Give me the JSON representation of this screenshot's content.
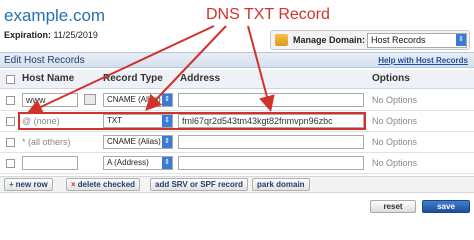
{
  "header": {
    "domain": "example.com",
    "expiration_label": "Expiration:",
    "expiration_date": "11/25/2019",
    "manage_label": "Manage Domain:",
    "manage_value": "Host Records"
  },
  "annotation": {
    "title": "DNS TXT Record",
    "color": "#d2322c"
  },
  "section": {
    "title": "Edit Host Records",
    "help_link": "Help with Host Records"
  },
  "columns": {
    "host": "Host Name",
    "type": "Record Type",
    "address": "Address",
    "options": "Options"
  },
  "rows": [
    {
      "host": "www",
      "type": "CNAME (Alias)",
      "address": "",
      "options": "No Options"
    },
    {
      "host": "@ (none)",
      "type": "TXT",
      "address": "fml67qr2d543tm43kgt82fnmvpn96zbc",
      "options": "No Options"
    },
    {
      "host": "* (all others)",
      "type": "CNAME (Alias)",
      "address": "",
      "options": "No Options"
    },
    {
      "host": "",
      "type": "A (Address)",
      "address": "",
      "options": "No Options"
    }
  ],
  "footer_buttons": {
    "new_row": "new row",
    "delete_checked": "delete checked",
    "add_srv": "add SRV or SPF record",
    "park_domain": "park domain"
  },
  "actions": {
    "reset": "reset",
    "save": "save"
  },
  "colors": {
    "accent": "#2a6fb0",
    "section_bg": "#d6e0ee"
  }
}
